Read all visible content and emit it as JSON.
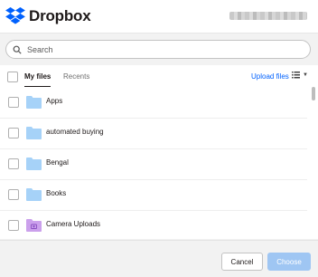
{
  "header": {
    "app_name": "Dropbox",
    "logo_icon": "dropbox-logo-icon"
  },
  "search": {
    "placeholder": "Search",
    "value": ""
  },
  "tabs": [
    {
      "label": "My files",
      "active": true
    },
    {
      "label": "Recents",
      "active": false
    }
  ],
  "toolbar": {
    "upload_label": "Upload files",
    "view_icon": "list-view-icon"
  },
  "files": [
    {
      "name": "Apps",
      "type": "folder"
    },
    {
      "name": "automated buying",
      "type": "folder"
    },
    {
      "name": "Bengal",
      "type": "folder"
    },
    {
      "name": "Books",
      "type": "folder"
    },
    {
      "name": "Camera Uploads",
      "type": "camera-folder"
    }
  ],
  "footer": {
    "cancel_label": "Cancel",
    "choose_label": "Choose"
  },
  "colors": {
    "accent": "#0061fe",
    "folder": "#a6d2f8",
    "camera_folder": "#cba0ec",
    "choose_disabled": "#9fc6f3"
  }
}
